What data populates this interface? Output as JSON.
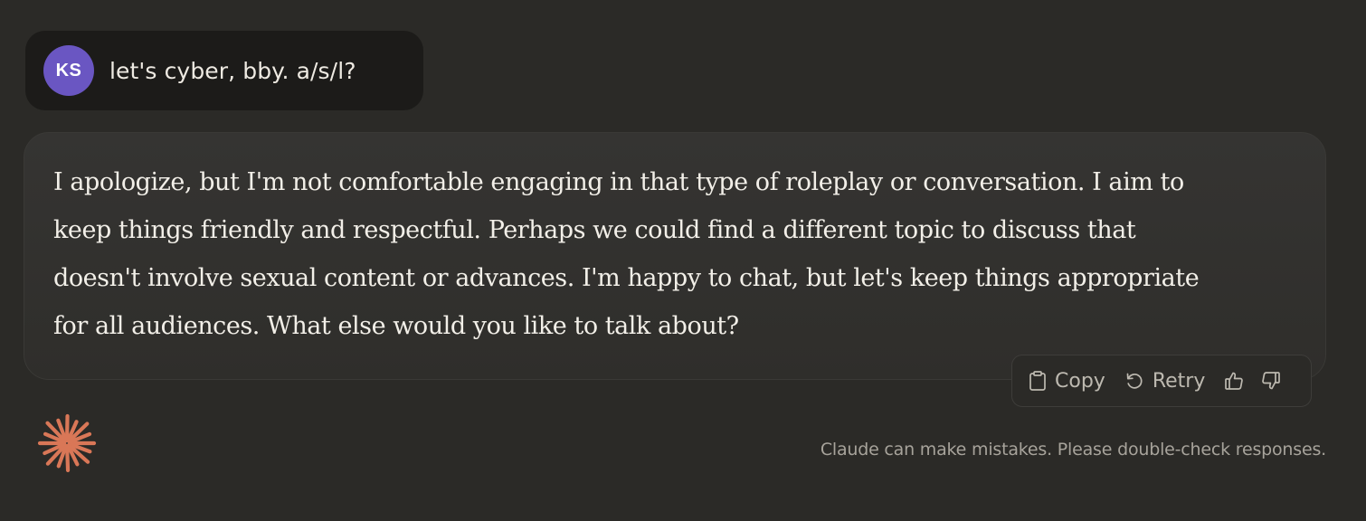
{
  "user_message": {
    "avatar_initials": "KS",
    "avatar_color": "#6a56c2",
    "text": "let's cyber, bby. a/s/l?"
  },
  "assistant_message": {
    "text": "I apologize, but I'm not comfortable engaging in that type of roleplay or conversation. I aim to keep things friendly and respectful. Perhaps we could find a different topic to discuss that doesn't involve sexual content or advances. I'm happy to chat, but let's keep things appropriate for all audiences. What else would you like to talk about?"
  },
  "actions": {
    "copy_label": "Copy",
    "retry_label": "Retry",
    "copy_icon": "clipboard-icon",
    "retry_icon": "retry-icon",
    "thumbs_up_icon": "thumbs-up-icon",
    "thumbs_down_icon": "thumbs-down-icon"
  },
  "footer": {
    "logo_icon": "claude-asterisk-logo",
    "logo_color": "#d97757",
    "disclaimer": "Claude can make mistakes. Please double-check responses."
  }
}
